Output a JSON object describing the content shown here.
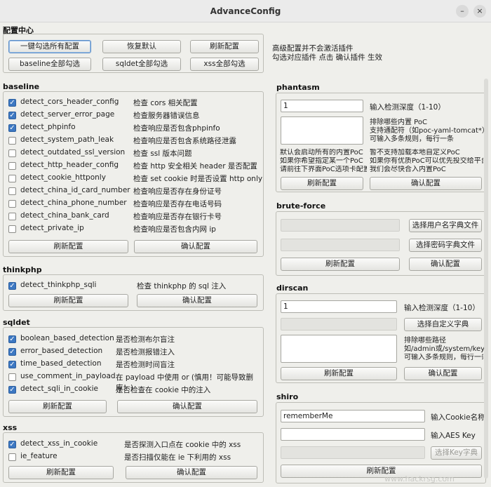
{
  "window": {
    "title": "AdvanceConfig",
    "minimize": "–",
    "close": "×"
  },
  "config_center": {
    "label": "配置中心",
    "buttons": {
      "select_all_config": "一键勾选所有配置",
      "restore_default": "恢复默认",
      "refresh_config": "刷新配置",
      "baseline_select_all": "baseline全部勾选",
      "sqldet_select_all": "sqldet全部勾选",
      "xss_select_all": "xss全部勾选"
    },
    "notes": [
      "高级配置并不会激活插件",
      "勾选对应插件 点击 确认插件 生效"
    ]
  },
  "baseline": {
    "label": "baseline",
    "items": [
      {
        "name": "detect_cors_header_config",
        "desc": "检查 cors 相关配置",
        "checked": true
      },
      {
        "name": "detect_server_error_page",
        "desc": "检查服务器错误信息",
        "checked": true
      },
      {
        "name": "detect_phpinfo",
        "desc": "检查响应是否包含phpinfo",
        "checked": true
      },
      {
        "name": "detect_system_path_leak",
        "desc": "检查响应是否包含系统路径泄露",
        "checked": false
      },
      {
        "name": "detect_outdated_ssl_version",
        "desc": "检查 ssl 版本问题",
        "checked": false
      },
      {
        "name": "detect_http_header_config",
        "desc": "检查 http 安全相关 header 是否配置",
        "checked": false
      },
      {
        "name": "detect_cookie_httponly",
        "desc": "检查 set cookie 时是否设置 http only",
        "checked": false
      },
      {
        "name": "detect_china_id_card_number",
        "desc": "检查响应是否存在身份证号",
        "checked": false
      },
      {
        "name": "detect_china_phone_number",
        "desc": "检查响应是否存在电话号码",
        "checked": false
      },
      {
        "name": "detect_china_bank_card",
        "desc": "检查响应是否存在银行卡号",
        "checked": false
      },
      {
        "name": "detect_private_ip",
        "desc": "检查响应是否包含内网 ip",
        "checked": false
      }
    ],
    "refresh": "刷新配置",
    "confirm": "确认配置"
  },
  "thinkphp": {
    "label": "thinkphp",
    "items": [
      {
        "name": "detect_thinkphp_sqli",
        "desc": "检查 thinkphp 的 sql 注入",
        "checked": true
      }
    ],
    "refresh": "刷新配置",
    "confirm": "确认配置"
  },
  "sqldet": {
    "label": "sqldet",
    "items": [
      {
        "name": "boolean_based_detection",
        "desc": "是否检测布尔盲注",
        "checked": true
      },
      {
        "name": "error_based_detection",
        "desc": "是否检测报错注入",
        "checked": true
      },
      {
        "name": "time_based_detection",
        "desc": "是否检测时间盲注",
        "checked": true
      },
      {
        "name": "use_comment_in_payload",
        "desc": "在 payload 中使用 or (慎用！可能导致删库！)",
        "checked": false
      },
      {
        "name": "detect_sqli_in_cookie",
        "desc": "是否检查在 cookie 中的注入",
        "checked": true
      }
    ],
    "refresh": "刷新配置",
    "confirm": "确认配置"
  },
  "xss": {
    "label": "xss",
    "items": [
      {
        "name": "detect_xss_in_cookie",
        "desc": "是否探测入口点在 cookie 中的 xss",
        "checked": true
      },
      {
        "name": "ie_feature",
        "desc": "是否扫描仅能在 ie 下利用的 xss",
        "checked": false
      }
    ],
    "refresh": "刷新配置",
    "confirm": "确认配置"
  },
  "phantasm": {
    "label": "phantasm",
    "depth_value": "1",
    "depth_label": "输入检测深度（1-10）",
    "exclude_note": [
      "排除哪些内置 PoC",
      "支持通配符（如poc-yaml-tomcat*）",
      "可输入多条规则，每行一条"
    ],
    "load_note": [
      "默认会启动所有的内置PoC",
      "如果你希望指定某一个PoC",
      "请前往下界面PoC选项卡配置"
    ],
    "custom_note": [
      "暂不支持加载本地自定义PoC",
      "如果你有优质PoC可以优先投交给平台",
      "我们会尽快合入内置PoC"
    ],
    "refresh": "刷新配置",
    "confirm": "确认配置"
  },
  "brute_force": {
    "label": "brute-force",
    "username_dict": "选择用户名字典文件",
    "password_dict": "选择密码字典文件",
    "refresh": "刷新配置",
    "confirm": "确认配置"
  },
  "dirscan": {
    "label": "dirscan",
    "depth_value": "1",
    "depth_label": "输入检测深度（1-10）",
    "custom_dict": "选择自定义字典",
    "exclude_note": [
      "排除哪些路径",
      "如/admin或/system/key",
      "可输入多条规则，每行一条"
    ],
    "refresh": "刷新配置",
    "confirm": "确认配置"
  },
  "shiro": {
    "label": "shiro",
    "cookie_value": "rememberMe",
    "cookie_label": "输入Cookie名称",
    "aes_value": "",
    "aes_label": "输入AES Key",
    "dict_button": "选择Key字典",
    "refresh": "刷新配置"
  },
  "watermark": "www.hackrsg.com"
}
